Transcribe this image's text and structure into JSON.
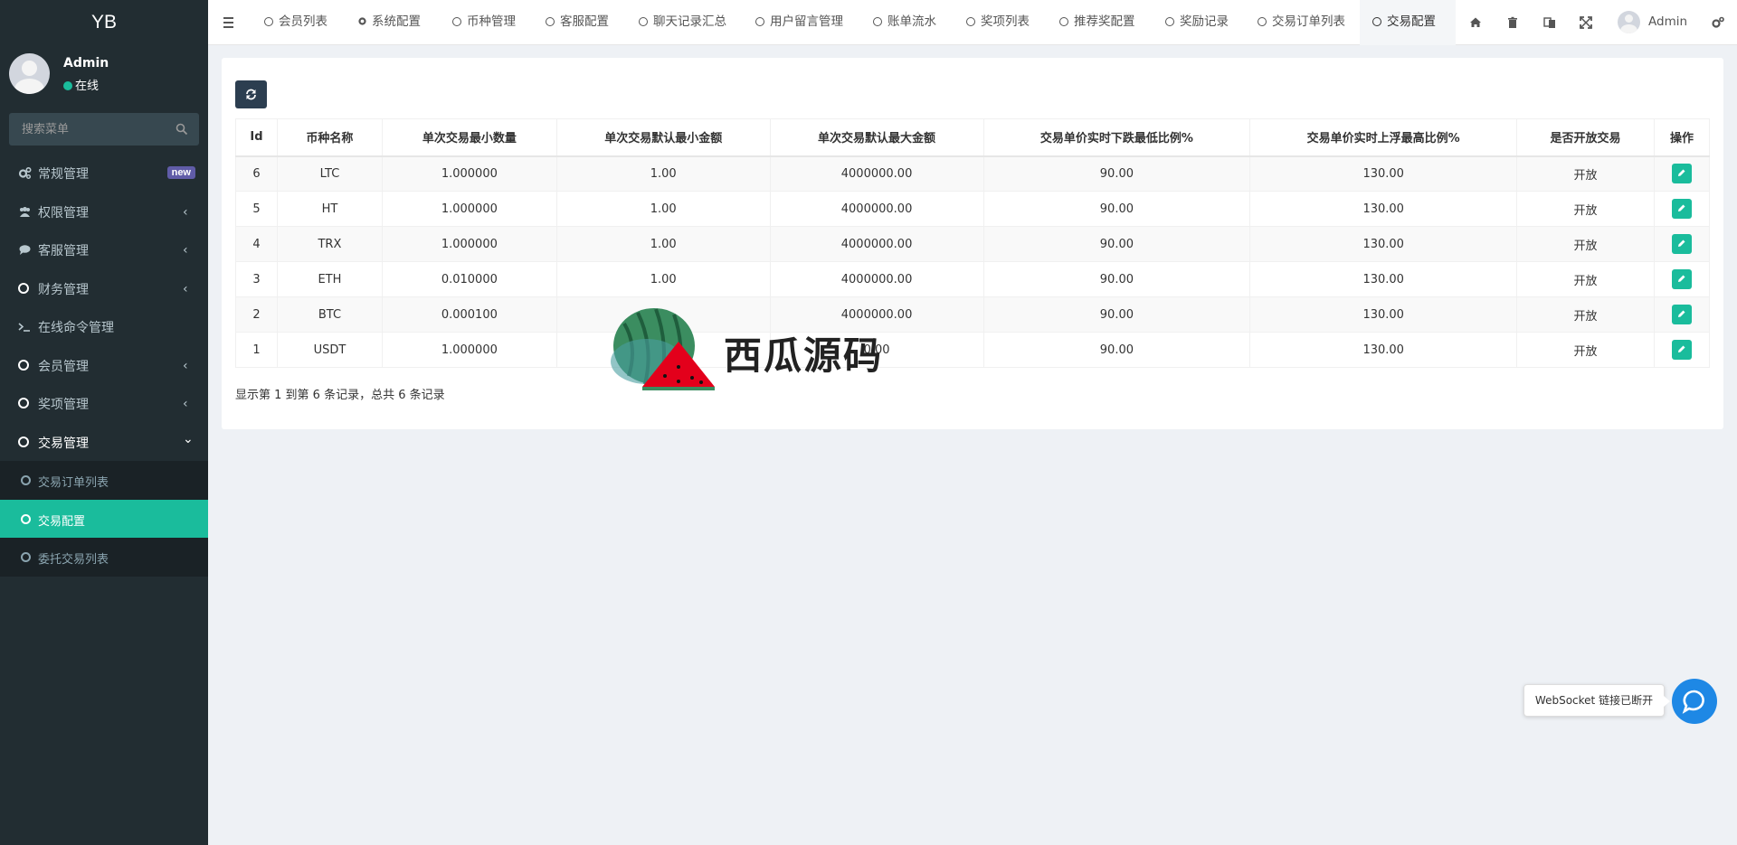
{
  "sidebar": {
    "logo": "YB",
    "user": {
      "name": "Admin",
      "status": "在线"
    },
    "search_placeholder": "搜索菜单",
    "items": [
      {
        "label": "常规管理",
        "icon": "gears-icon",
        "badge": "new"
      },
      {
        "label": "权限管理",
        "icon": "group-icon",
        "arrow": "‹"
      },
      {
        "label": "客服管理",
        "icon": "comment-icon",
        "arrow": "‹"
      },
      {
        "label": "财务管理",
        "icon": "circle-icon",
        "arrow": "‹"
      },
      {
        "label": "在线命令管理",
        "icon": "terminal-icon"
      },
      {
        "label": "会员管理",
        "icon": "circle-icon",
        "arrow": "‹"
      },
      {
        "label": "奖项管理",
        "icon": "circle-icon",
        "arrow": "‹"
      },
      {
        "label": "交易管理",
        "icon": "circle-icon",
        "arrow": "⌄"
      }
    ],
    "sub_items": [
      {
        "label": "交易订单列表"
      },
      {
        "label": "交易配置"
      },
      {
        "label": "委托交易列表"
      }
    ]
  },
  "topbar": {
    "tabs": [
      {
        "label": "会员列表"
      },
      {
        "label": "系统配置"
      },
      {
        "label": "币种管理"
      },
      {
        "label": "客服配置"
      },
      {
        "label": "聊天记录汇总"
      },
      {
        "label": "用户留言管理"
      },
      {
        "label": "账单流水"
      },
      {
        "label": "奖项列表"
      },
      {
        "label": "推荐奖配置"
      },
      {
        "label": "奖励记录"
      },
      {
        "label": "交易订单列表"
      },
      {
        "label": "交易配置"
      }
    ],
    "user_name": "Admin"
  },
  "table": {
    "columns": [
      "Id",
      "币种名称",
      "单次交易最小数量",
      "单次交易默认最小金额",
      "单次交易默认最大金额",
      "交易单价实时下跌最低比例%",
      "交易单价实时上浮最高比例%",
      "是否开放交易",
      "操作"
    ],
    "rows": [
      [
        "6",
        "LTC",
        "1.000000",
        "1.00",
        "4000000.00",
        "90.00",
        "130.00",
        "开放"
      ],
      [
        "5",
        "HT",
        "1.000000",
        "1.00",
        "4000000.00",
        "90.00",
        "130.00",
        "开放"
      ],
      [
        "4",
        "TRX",
        "1.000000",
        "1.00",
        "4000000.00",
        "90.00",
        "130.00",
        "开放"
      ],
      [
        "3",
        "ETH",
        "0.010000",
        "1.00",
        "4000000.00",
        "90.00",
        "130.00",
        "开放"
      ],
      [
        "2",
        "BTC",
        "0.000100",
        "",
        "4000000.00",
        "90.00",
        "130.00",
        "开放"
      ],
      [
        "1",
        "USDT",
        "1.000000",
        "",
        "0.00",
        "90.00",
        "130.00",
        "开放"
      ]
    ]
  },
  "pager_info": "显示第 1 到第 6 条记录，总共 6 条记录",
  "watermark_text": "西瓜源码",
  "ws_tip": "WebSocket 链接已断开",
  "colors": {
    "sidebar": "#222d32",
    "accent": "#1abc9c",
    "refresh": "#2c3e50",
    "badge": "#605ca8",
    "chat": "#1e88e5"
  }
}
